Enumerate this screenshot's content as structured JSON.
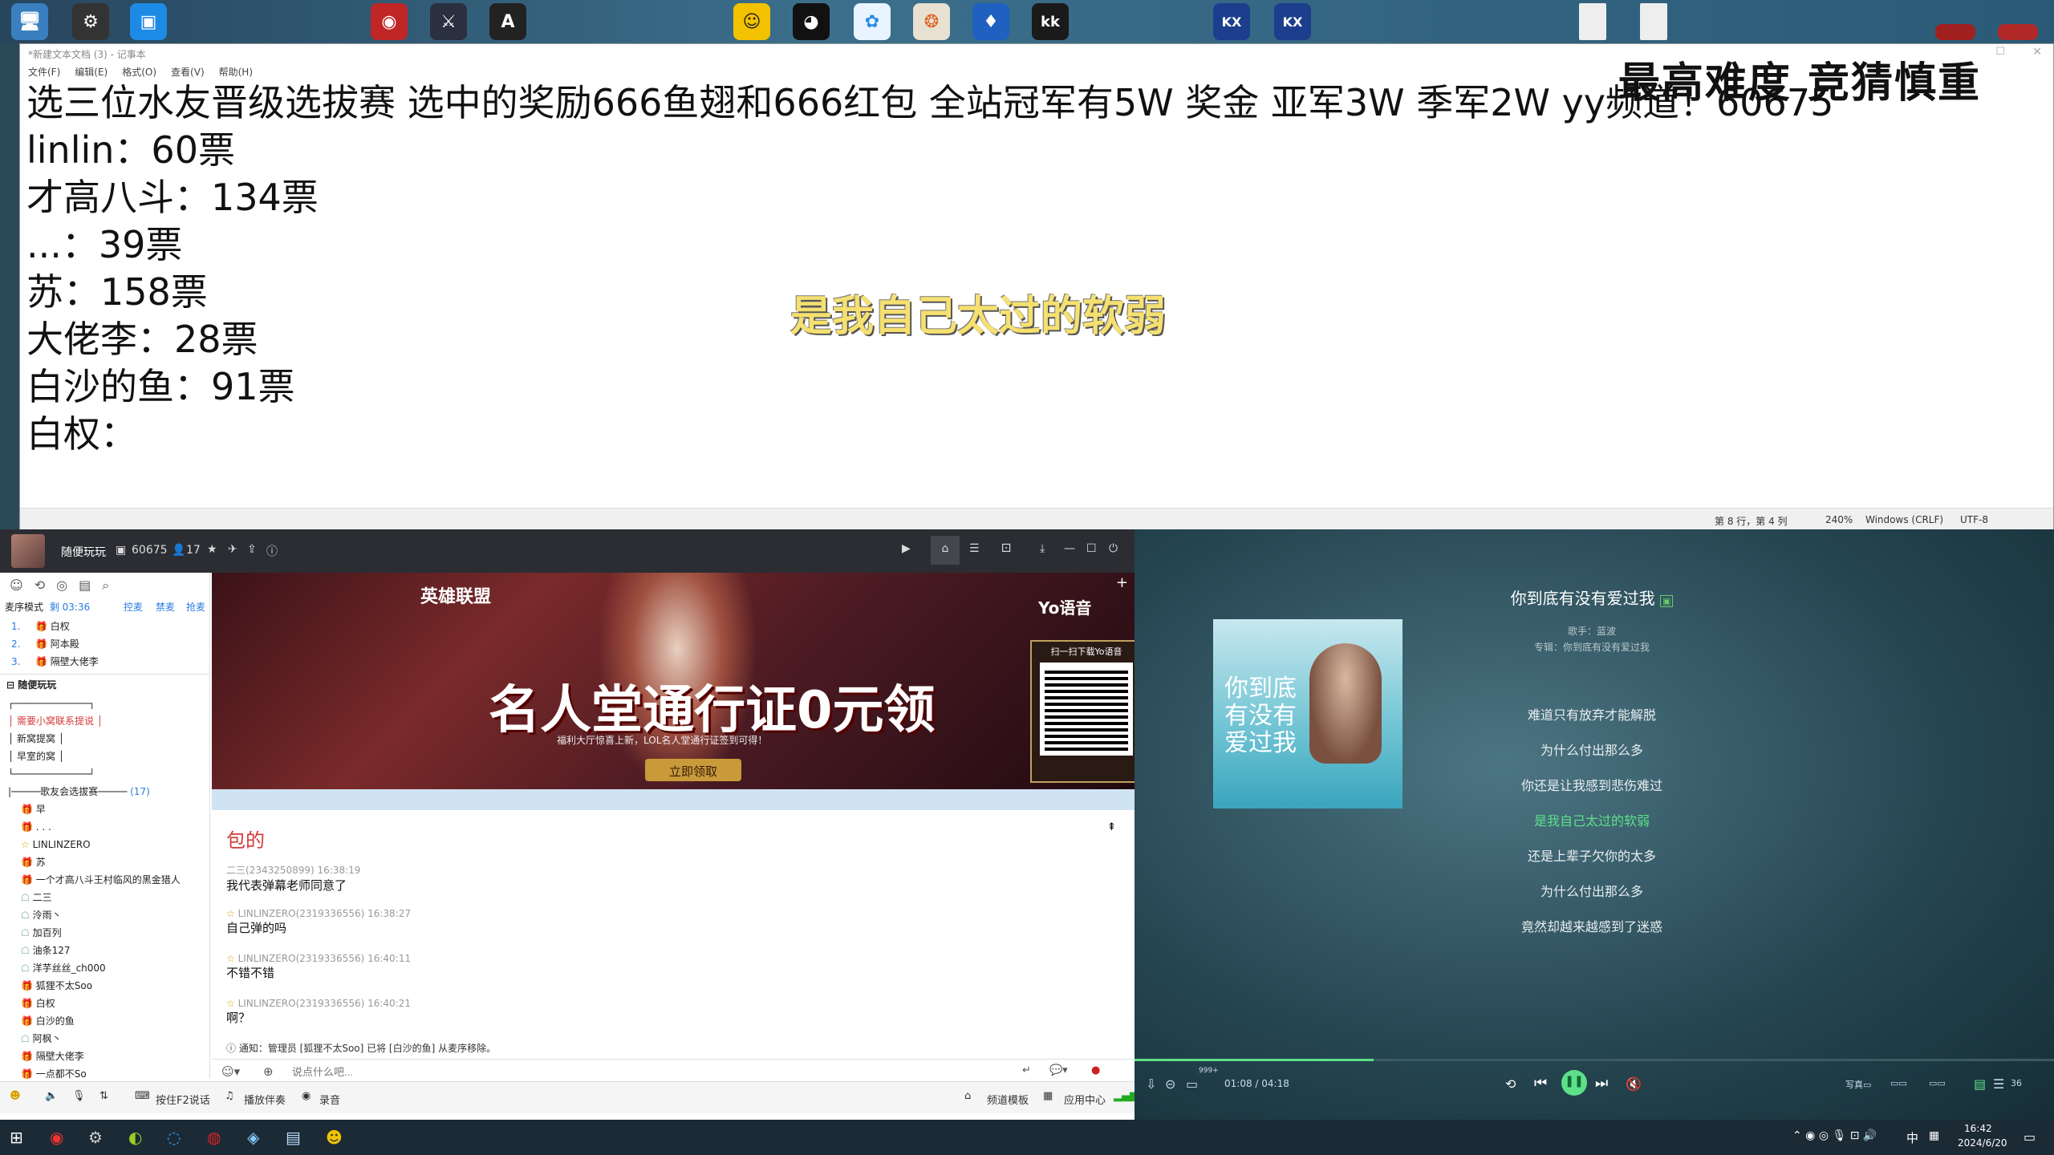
{
  "desktop": {
    "icons": [
      {
        "name": "computer",
        "glyph": "🖥"
      },
      {
        "name": "camera-app",
        "glyph": "⚙"
      },
      {
        "name": "tencent-docs",
        "glyph": "▣"
      },
      {
        "name": "game-launcher-1",
        "glyph": "◉"
      },
      {
        "name": "league-of-legends",
        "glyph": "⚔"
      },
      {
        "name": "app-a",
        "glyph": "A"
      },
      {
        "name": "yy-voice",
        "glyph": "☺"
      },
      {
        "name": "qq",
        "glyph": "◕"
      },
      {
        "name": "baidu-netdisk",
        "glyph": "✿"
      },
      {
        "name": "fish-app",
        "glyph": "❂"
      },
      {
        "name": "game-app",
        "glyph": "♦"
      },
      {
        "name": "kk-app",
        "glyph": "kk"
      },
      {
        "name": "kx-app-1",
        "glyph": "KX"
      },
      {
        "name": "kx-app-2",
        "glyph": "KX"
      }
    ]
  },
  "notepad": {
    "title": "*新建文本文档 (3) - 记事本",
    "menu": [
      "文件(F)",
      "编辑(E)",
      "格式(O)",
      "查看(V)",
      "帮助(H)"
    ],
    "lines": [
      "选三位水友晋级选拔赛   选中的奖励666鱼翅和666红包  全站冠军有5W 奖金  亚军3W  季军2W  yy频道！60675",
      "linlin：60票",
      "才高八斗：134票",
      "...：39票",
      "苏：158票",
      "大佬李：28票",
      "白沙的鱼：91票",
      "白权："
    ],
    "overlay": "最高难度  竞猜慎重",
    "status": {
      "position": "第 8 行，第 4 列",
      "zoom": "240%",
      "eol": "Windows (CRLF)",
      "encoding": "UTF-8"
    }
  },
  "desktop_lyric": "是我自己太过的软弱",
  "yy": {
    "channel_name": "随便玩玩",
    "channel_id": "60675",
    "online": "17",
    "mode": "麦序模式",
    "mode_time": "剩 03:36",
    "mode_actions": [
      "控麦",
      "禁麦",
      "抢麦"
    ],
    "queue": [
      {
        "rank": "1.",
        "name": "白权"
      },
      {
        "rank": "2.",
        "name": "阿本殿"
      },
      {
        "rank": "3.",
        "name": "隔壁大佬李"
      }
    ],
    "tree_root": "随便玩玩",
    "tree_items": [
      "┌─────────────┐",
      "│   需要小窝联系提说   │",
      "│     新窝提窝     │",
      "│     早室的窝     │",
      "└─────────────┘",
      "|─────歌友会选拔赛─────",
      "早",
      ". . .",
      "LINLINZERO",
      "苏",
      "一个才高八斗王村临风的黑金猎人",
      "二三",
      "泠雨丶",
      "加百列",
      "油条127",
      "洋芋丝丝_ch000",
      "狐狸不太Soo",
      "白权",
      "白沙的鱼",
      "阿枫丶",
      "隔壁大佬李",
      "一点都不So"
    ],
    "tree_count": "(17)",
    "banner": {
      "game_logo": "英雄联盟",
      "title": "名人堂通行证0元领",
      "subtitle": "福利大厅惊喜上新，LOL名人堂通行证签到可得！",
      "button": "立即领取",
      "brand": "Yo语音",
      "qr_caption": "扫一扫下载Yo语音"
    },
    "chat": [
      {
        "type": "big",
        "text": "包的"
      },
      {
        "type": "msg",
        "user": "二三(2343250899)",
        "time": "16:38:19",
        "text": "我代表弹幕老师同意了"
      },
      {
        "type": "msg",
        "user": "LINLINZERO(2319336556)",
        "time": "16:38:27",
        "text": "自己弹的吗"
      },
      {
        "type": "msg",
        "user": "LINLINZERO(2319336556)",
        "time": "16:40:11",
        "text": "不错不错"
      },
      {
        "type": "msg",
        "user": "LINLINZERO(2319336556)",
        "time": "16:40:21",
        "text": "啊？"
      }
    ],
    "notice": "通知：管理员 [狐狸不太Soo] 已将 [白沙的鱼] 从麦序移除。",
    "input_placeholder": "说点什么吧...",
    "bottom": [
      "按住F2说话",
      "播放伴奏",
      "录音",
      "频道模板",
      "应用中心"
    ]
  },
  "player": {
    "song": "你到底有没有爱过我",
    "singer": "歌手：蓝波",
    "album": "专辑：你到底有没有爱过我",
    "cover_text": "你到底有没有爱过我",
    "lyrics": [
      "难道只有放弃才能解脱",
      "为什么付出那么多",
      "你还是让我感到悲伤难过",
      "是我自己太过的软弱",
      "还是上辈子欠你的太多",
      "为什么付出那么多",
      "竟然却越来越感到了迷惑"
    ],
    "active_lyric_index": 3,
    "time": "01:08 / 04:18",
    "progress": 0.26,
    "comment_count": "999+",
    "lyric_count": "36"
  },
  "taskbar": {
    "time": "16:42",
    "date": "2024/6/20",
    "ime": "中"
  },
  "colors": {
    "active_lyric": "#5de08a",
    "desktop_lyric": "#f5e070",
    "yy_dark": "#2b2d33",
    "red_text": "#d23a3a"
  }
}
